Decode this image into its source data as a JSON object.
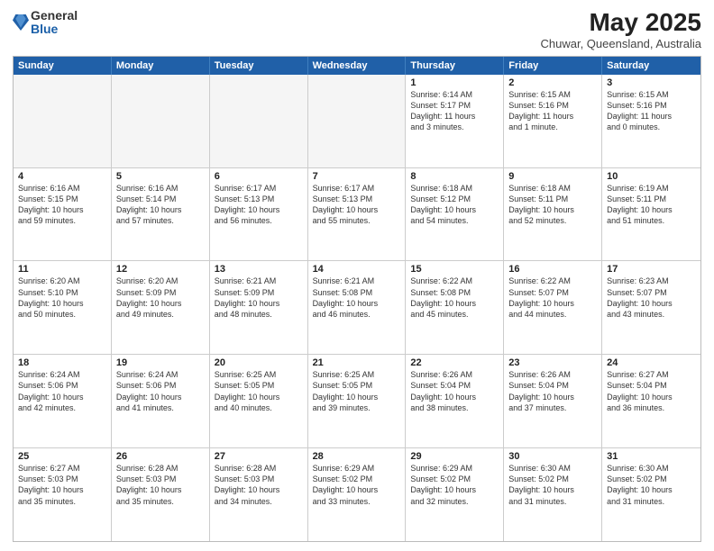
{
  "logo": {
    "general": "General",
    "blue": "Blue"
  },
  "title": "May 2025",
  "location": "Chuwar, Queensland, Australia",
  "headers": [
    "Sunday",
    "Monday",
    "Tuesday",
    "Wednesday",
    "Thursday",
    "Friday",
    "Saturday"
  ],
  "rows": [
    [
      {
        "day": "",
        "info": "",
        "empty": true
      },
      {
        "day": "",
        "info": "",
        "empty": true
      },
      {
        "day": "",
        "info": "",
        "empty": true
      },
      {
        "day": "",
        "info": "",
        "empty": true
      },
      {
        "day": "1",
        "info": "Sunrise: 6:14 AM\nSunset: 5:17 PM\nDaylight: 11 hours\nand 3 minutes."
      },
      {
        "day": "2",
        "info": "Sunrise: 6:15 AM\nSunset: 5:16 PM\nDaylight: 11 hours\nand 1 minute."
      },
      {
        "day": "3",
        "info": "Sunrise: 6:15 AM\nSunset: 5:16 PM\nDaylight: 11 hours\nand 0 minutes."
      }
    ],
    [
      {
        "day": "4",
        "info": "Sunrise: 6:16 AM\nSunset: 5:15 PM\nDaylight: 10 hours\nand 59 minutes."
      },
      {
        "day": "5",
        "info": "Sunrise: 6:16 AM\nSunset: 5:14 PM\nDaylight: 10 hours\nand 57 minutes."
      },
      {
        "day": "6",
        "info": "Sunrise: 6:17 AM\nSunset: 5:13 PM\nDaylight: 10 hours\nand 56 minutes."
      },
      {
        "day": "7",
        "info": "Sunrise: 6:17 AM\nSunset: 5:13 PM\nDaylight: 10 hours\nand 55 minutes."
      },
      {
        "day": "8",
        "info": "Sunrise: 6:18 AM\nSunset: 5:12 PM\nDaylight: 10 hours\nand 54 minutes."
      },
      {
        "day": "9",
        "info": "Sunrise: 6:18 AM\nSunset: 5:11 PM\nDaylight: 10 hours\nand 52 minutes."
      },
      {
        "day": "10",
        "info": "Sunrise: 6:19 AM\nSunset: 5:11 PM\nDaylight: 10 hours\nand 51 minutes."
      }
    ],
    [
      {
        "day": "11",
        "info": "Sunrise: 6:20 AM\nSunset: 5:10 PM\nDaylight: 10 hours\nand 50 minutes."
      },
      {
        "day": "12",
        "info": "Sunrise: 6:20 AM\nSunset: 5:09 PM\nDaylight: 10 hours\nand 49 minutes."
      },
      {
        "day": "13",
        "info": "Sunrise: 6:21 AM\nSunset: 5:09 PM\nDaylight: 10 hours\nand 48 minutes."
      },
      {
        "day": "14",
        "info": "Sunrise: 6:21 AM\nSunset: 5:08 PM\nDaylight: 10 hours\nand 46 minutes."
      },
      {
        "day": "15",
        "info": "Sunrise: 6:22 AM\nSunset: 5:08 PM\nDaylight: 10 hours\nand 45 minutes."
      },
      {
        "day": "16",
        "info": "Sunrise: 6:22 AM\nSunset: 5:07 PM\nDaylight: 10 hours\nand 44 minutes."
      },
      {
        "day": "17",
        "info": "Sunrise: 6:23 AM\nSunset: 5:07 PM\nDaylight: 10 hours\nand 43 minutes."
      }
    ],
    [
      {
        "day": "18",
        "info": "Sunrise: 6:24 AM\nSunset: 5:06 PM\nDaylight: 10 hours\nand 42 minutes."
      },
      {
        "day": "19",
        "info": "Sunrise: 6:24 AM\nSunset: 5:06 PM\nDaylight: 10 hours\nand 41 minutes."
      },
      {
        "day": "20",
        "info": "Sunrise: 6:25 AM\nSunset: 5:05 PM\nDaylight: 10 hours\nand 40 minutes."
      },
      {
        "day": "21",
        "info": "Sunrise: 6:25 AM\nSunset: 5:05 PM\nDaylight: 10 hours\nand 39 minutes."
      },
      {
        "day": "22",
        "info": "Sunrise: 6:26 AM\nSunset: 5:04 PM\nDaylight: 10 hours\nand 38 minutes."
      },
      {
        "day": "23",
        "info": "Sunrise: 6:26 AM\nSunset: 5:04 PM\nDaylight: 10 hours\nand 37 minutes."
      },
      {
        "day": "24",
        "info": "Sunrise: 6:27 AM\nSunset: 5:04 PM\nDaylight: 10 hours\nand 36 minutes."
      }
    ],
    [
      {
        "day": "25",
        "info": "Sunrise: 6:27 AM\nSunset: 5:03 PM\nDaylight: 10 hours\nand 35 minutes."
      },
      {
        "day": "26",
        "info": "Sunrise: 6:28 AM\nSunset: 5:03 PM\nDaylight: 10 hours\nand 35 minutes."
      },
      {
        "day": "27",
        "info": "Sunrise: 6:28 AM\nSunset: 5:03 PM\nDaylight: 10 hours\nand 34 minutes."
      },
      {
        "day": "28",
        "info": "Sunrise: 6:29 AM\nSunset: 5:02 PM\nDaylight: 10 hours\nand 33 minutes."
      },
      {
        "day": "29",
        "info": "Sunrise: 6:29 AM\nSunset: 5:02 PM\nDaylight: 10 hours\nand 32 minutes."
      },
      {
        "day": "30",
        "info": "Sunrise: 6:30 AM\nSunset: 5:02 PM\nDaylight: 10 hours\nand 31 minutes."
      },
      {
        "day": "31",
        "info": "Sunrise: 6:30 AM\nSunset: 5:02 PM\nDaylight: 10 hours\nand 31 minutes."
      }
    ]
  ]
}
